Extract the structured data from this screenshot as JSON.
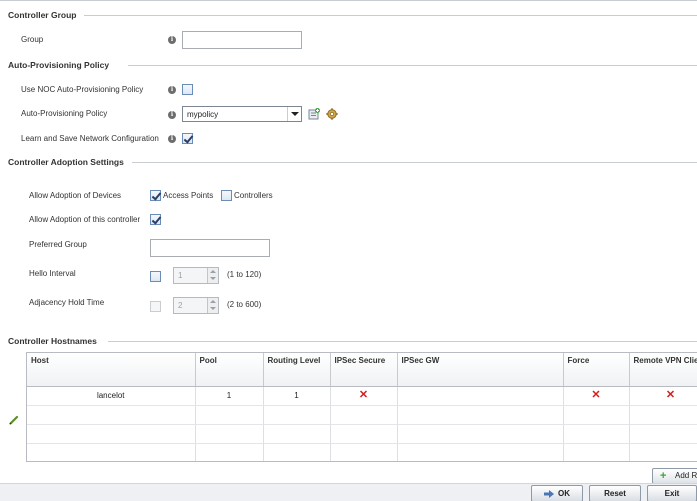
{
  "sections": {
    "controller_group": "Controller Group",
    "auto_provisioning": "Auto-Provisioning Policy",
    "adoption_settings": "Controller Adoption Settings",
    "hostnames": "Controller Hostnames"
  },
  "controller_group": {
    "group_label": "Group",
    "group_value": ""
  },
  "auto_provisioning": {
    "use_noc_label": "Use NOC Auto-Provisioning Policy",
    "use_noc_checked": false,
    "policy_label": "Auto-Provisioning Policy",
    "policy_value": "mypolicy",
    "learn_save_label": "Learn and Save Network Configuration",
    "learn_save_checked": true
  },
  "adoption": {
    "allow_devices_label": "Allow Adoption of Devices",
    "access_points_label": "Access Points",
    "access_points_checked": true,
    "controllers_label": "Controllers",
    "controllers_checked": false,
    "allow_this_label": "Allow Adoption of this controller",
    "allow_this_checked": true,
    "preferred_group_label": "Preferred Group",
    "preferred_group_value": "",
    "hello_interval_label": "Hello Interval",
    "hello_interval_value": "1",
    "hello_interval_range": "(1 to 120)",
    "adjacency_label": "Adjacency Hold Time",
    "adjacency_value": "2",
    "adjacency_range": "(2 to 600)"
  },
  "hostnames_table": {
    "columns": [
      "Host",
      "Pool",
      "Routing Level",
      "IPSec Secure",
      "IPSec GW",
      "Force",
      "Remote VPN Client"
    ],
    "rows": [
      {
        "host": "lancelot",
        "pool": "1",
        "routing_level": "1",
        "ipsec_secure": "✕",
        "ipsec_gw": "",
        "force": "✕",
        "remote_vpn": "✕"
      }
    ]
  },
  "buttons": {
    "add_row": "Add Row",
    "ok": "OK",
    "reset": "Reset",
    "exit": "Exit"
  },
  "icons": {
    "info": "i",
    "x_mark_color": "#d21e1e"
  }
}
